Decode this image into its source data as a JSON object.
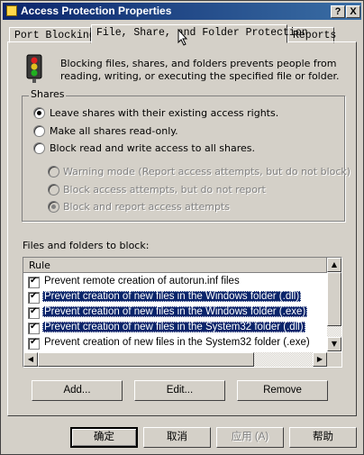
{
  "window": {
    "title": "Access Protection Properties",
    "help_btn": "?",
    "close_btn": "X"
  },
  "tabs": [
    {
      "label": "Port Blocking"
    },
    {
      "label": "File, Share, and Folder Protection"
    },
    {
      "label": "Reports"
    }
  ],
  "description": "Blocking files, shares, and folders prevents people from reading, writing, or executing the specified file or folder.",
  "shares": {
    "label": "Shares",
    "options": [
      "Leave shares with their existing access rights.",
      "Make all shares read-only.",
      "Block read and write access to all shares."
    ],
    "selected": 0,
    "sub_options": [
      "Warning mode (Report access attempts, but do not block)",
      "Block access attempts, but do not report",
      "Block and report access attempts"
    ],
    "sub_selected": 2
  },
  "files": {
    "label": "Files and folders to block:",
    "column": "Rule",
    "rows": [
      {
        "text": "Prevent remote creation of autorun.inf files",
        "checked": true,
        "selected": false
      },
      {
        "text": "Prevent creation of new files in the Windows folder (.dll)",
        "checked": true,
        "selected": true
      },
      {
        "text": "Prevent creation of new files in the Windows folder (.exe)",
        "checked": true,
        "selected": true
      },
      {
        "text": "Prevent creation of new files in the System32 folder (.dll)",
        "checked": true,
        "selected": true
      },
      {
        "text": "Prevent creation of new files in the System32 folder (.exe)",
        "checked": true,
        "selected": false
      }
    ]
  },
  "actions": {
    "add": "Add...",
    "edit": "Edit...",
    "remove": "Remove"
  },
  "footer": {
    "ok": "确定",
    "cancel": "取消",
    "apply": "应用 (A)",
    "help": "帮助"
  },
  "colors": {
    "title_bar": "#0a246a",
    "face": "#d4d0c8",
    "selection": "#0a246a"
  },
  "icons": [
    "traffic-light-icon",
    "mouse-cursor-icon"
  ]
}
